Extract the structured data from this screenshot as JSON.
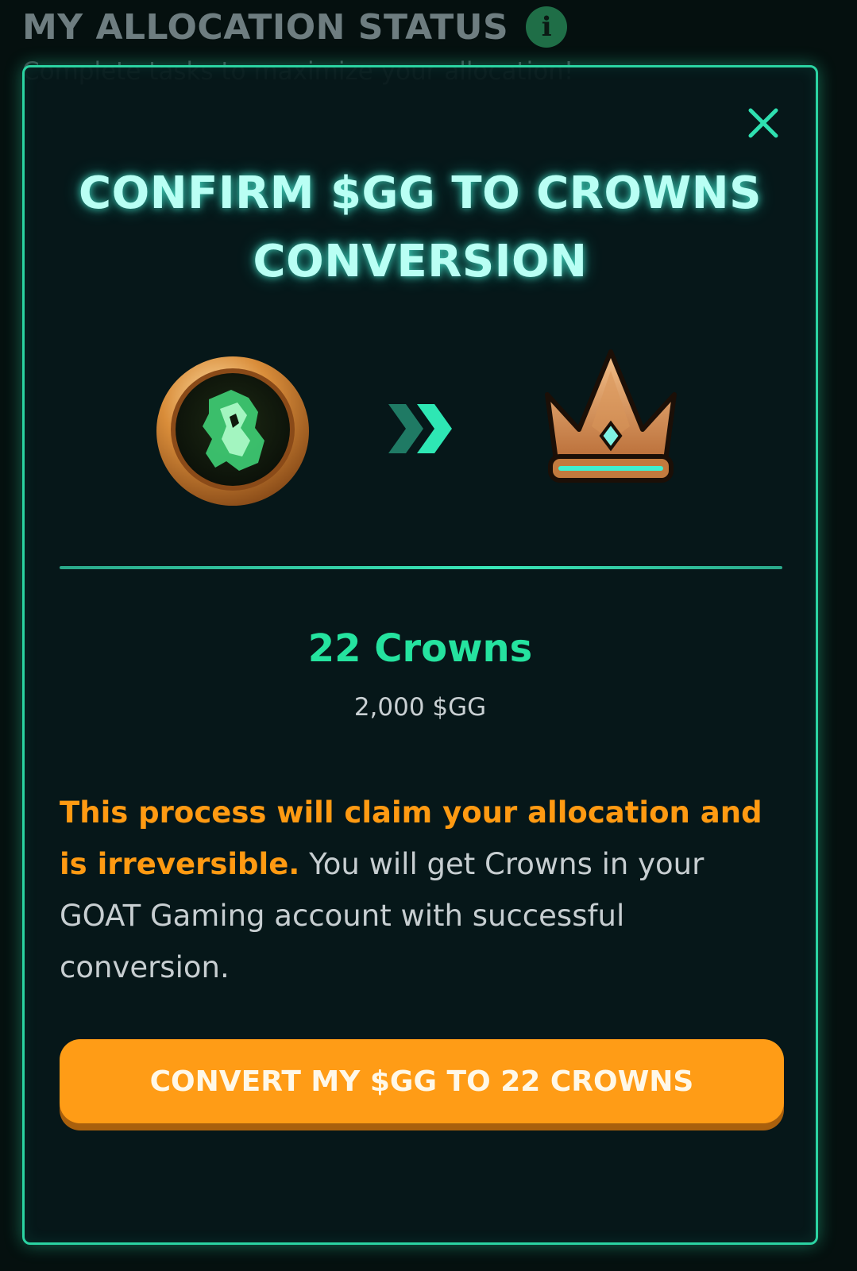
{
  "background": {
    "header_title": "MY ALLOCATION STATUS",
    "info_glyph": "i",
    "subtitle": "Complete tasks to maximize your allocation!"
  },
  "modal": {
    "title_line1": "CONFIRM $GG TO CROWNS",
    "title_line2": "CONVERSION",
    "crowns_amount": "22 Crowns",
    "gg_amount": "2,000 $GG",
    "warning_text": "This process will claim your allocation and is irreversible.",
    "info_text": " You will get Crowns in your GOAT Gaming account with successful conversion.",
    "convert_button": "CONVERT MY $GG TO 22 CROWNS",
    "icons": {
      "close": "close-icon",
      "from": "gg-coin-icon",
      "arrow": "double-chevron-right-icon",
      "to": "crown-icon"
    },
    "colors": {
      "accent": "#2bd3a2",
      "crowns_green": "#25e39f",
      "warning_orange": "#ff9a12",
      "button_orange": "#ff9c16"
    }
  }
}
